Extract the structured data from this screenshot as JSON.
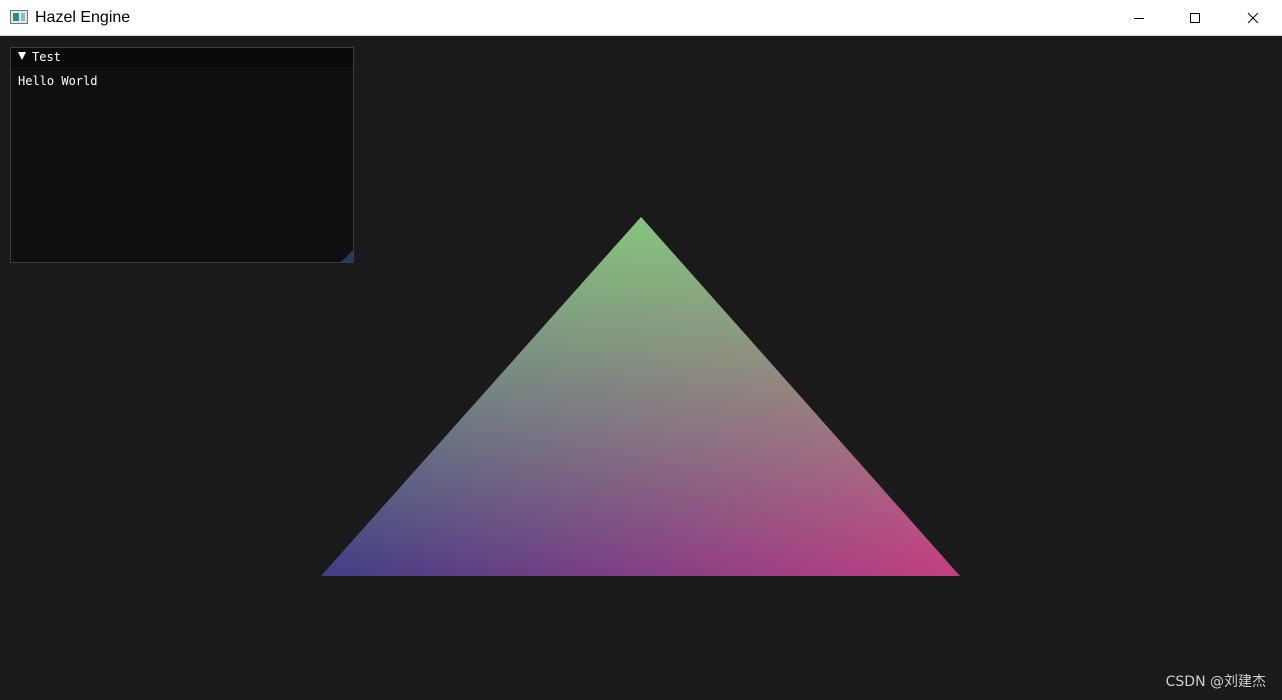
{
  "window": {
    "title": "Hazel Engine",
    "icons": {
      "app": "app-window-icon",
      "minimize": "minimize-icon",
      "maximize": "maximize-icon",
      "close": "close-icon"
    }
  },
  "viewport": {
    "background": "#1a1a1a",
    "triangle": {
      "colors": {
        "top": "#86c57e",
        "bottom_left": "#3f3f86",
        "bottom_right": "#c63e82"
      }
    }
  },
  "imgui_panel": {
    "title": "Test",
    "text": "Hello World",
    "icons": {
      "collapse": "collapse-arrow-icon",
      "resize": "resize-grip-icon"
    }
  },
  "watermark": {
    "text": "CSDN @刘建杰"
  }
}
